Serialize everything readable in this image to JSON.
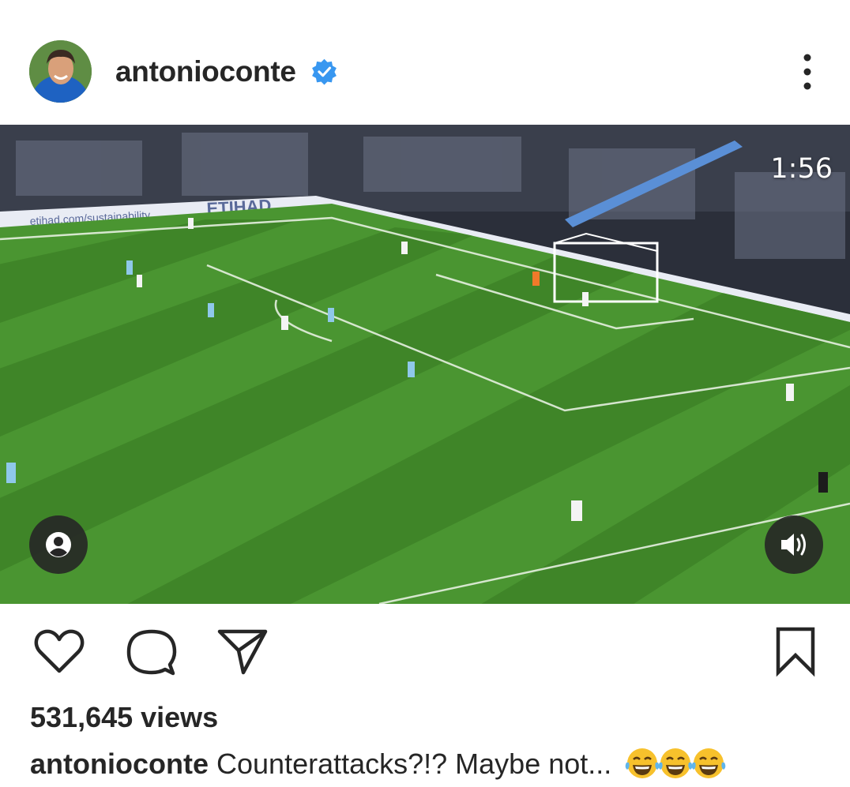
{
  "post": {
    "username": "antonioconte",
    "verified": true,
    "video": {
      "duration_label": "1:56",
      "banner_text_1": "etihad.com/sustainability",
      "banner_text_2": "ETIHAD"
    },
    "views_label": "531,645 views",
    "caption_user": "antonioconte",
    "caption_text": "Counterattacks?!? Maybe not...",
    "caption_emojis": [
      "face-with-tears-of-joy",
      "face-with-tears-of-joy",
      "face-with-tears-of-joy"
    ]
  },
  "icons": {
    "verified": "verified-badge-icon",
    "more": "more-options-icon",
    "tag": "tagged-people-icon",
    "sound": "sound-on-icon",
    "like": "heart-icon",
    "comment": "comment-icon",
    "share": "share-icon",
    "save": "bookmark-icon"
  },
  "colors": {
    "verified_blue": "#3897f0",
    "text": "#262626",
    "pitch_light": "#4f9a35",
    "pitch_dark": "#3b7d26"
  }
}
